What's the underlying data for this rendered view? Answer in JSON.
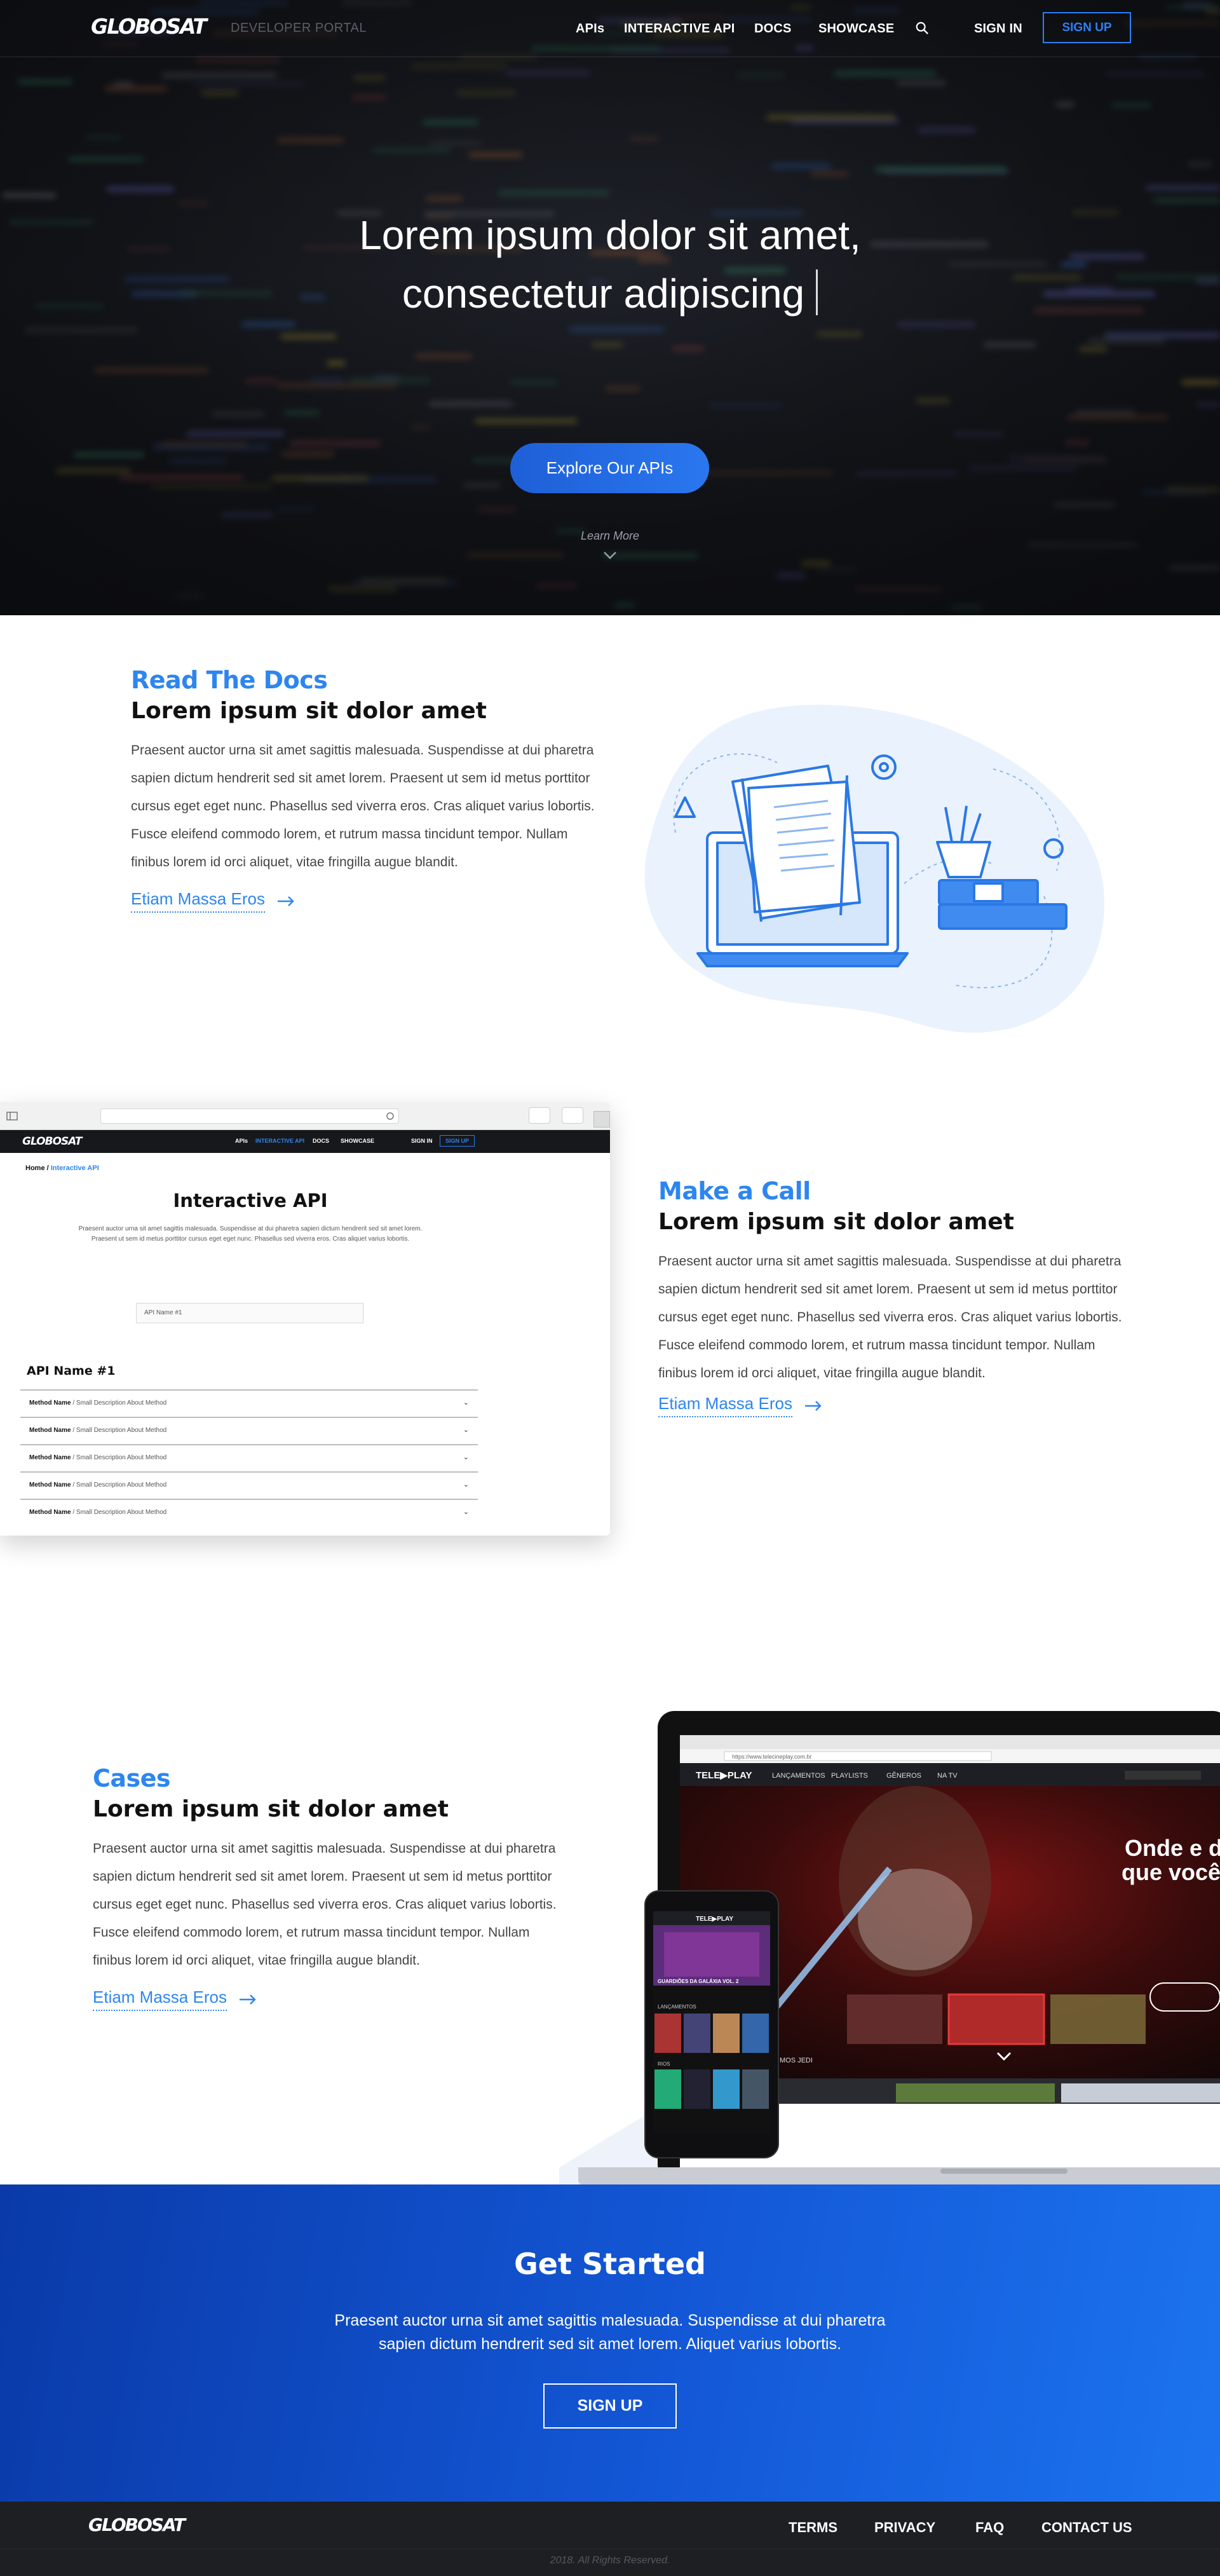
{
  "brand": {
    "logo": "GLOBOSAT",
    "subtitle": "DEVELOPER PORTAL"
  },
  "nav": {
    "items": [
      "APIs",
      "INTERACTIVE API",
      "DOCS",
      "SHOWCASE"
    ],
    "search_icon": "search-icon",
    "signin": "SIGN IN",
    "signup": "SIGN UP"
  },
  "hero": {
    "line1": "Lorem ipsum dolor sit amet,",
    "line2": "consectetur adipiscing",
    "cta": "Explore Our APIs",
    "learn_more": "Learn More"
  },
  "sections": [
    {
      "kicker": "Read The Docs",
      "title": "Lorem ipsum sit dolor amet",
      "body": "Praesent auctor urna sit amet sagittis malesuada. Suspendisse at dui pharetra sapien dictum hendrerit sed sit amet lorem. Praesent ut sem id metus porttitor cursus eget eget nunc. Phasellus sed viverra eros. Cras aliquet varius lobortis. Fusce eleifend commodo lorem, et rutrum massa tincidunt tempor. Nullam finibus lorem id orci aliquet, vitae fringilla augue blandit.",
      "link": "Etiam Massa Eros"
    },
    {
      "kicker": "Make a Call",
      "title": "Lorem ipsum sit dolor amet",
      "body": "Praesent auctor urna sit amet sagittis malesuada. Suspendisse at dui pharetra sapien dictum hendrerit sed sit amet lorem. Praesent ut sem id metus porttitor cursus eget eget nunc. Phasellus sed viverra eros. Cras aliquet varius lobortis. Fusce eleifend commodo lorem, et rutrum massa tincidunt tempor. Nullam finibus lorem id orci aliquet, vitae fringilla augue blandit.",
      "link": "Etiam Massa Eros"
    },
    {
      "kicker": "Cases",
      "title": "Lorem ipsum sit dolor amet",
      "body": "Praesent auctor urna sit amet sagittis malesuada. Suspendisse at dui pharetra sapien dictum hendrerit sed sit amet lorem. Praesent ut sem id metus porttitor cursus eget eget nunc. Phasellus sed viverra eros. Cras aliquet varius lobortis. Fusce eleifend commodo lorem, et rutrum massa tincidunt tempor. Nullam finibus lorem id orci aliquet, vitae fringilla augue blandit.",
      "link": "Etiam Massa Eros"
    }
  ],
  "mock": {
    "logo": "GLOBOSAT",
    "nav": [
      "APIs",
      "INTERACTIVE API",
      "DOCS",
      "SHOWCASE"
    ],
    "signin": "SIGN IN",
    "signup": "SIGN UP",
    "crumb_home": "Home",
    "crumb_current": "Interactive API",
    "title": "Interactive API",
    "desc": "Praesent auctor urna sit amet sagittis malesuada. Suspendisse at dui pharetra sapien dictum hendrerit sed sit amet lorem. Praesent ut sem id metus porttitor cursus eget eget nunc. Phasellus sed viverra eros. Cras aliquet varius lobortis.",
    "select": "API Name #1",
    "api_heading": "API Name #1",
    "rows": [
      {
        "name": "Method Name",
        "desc": "Small Description About Method"
      },
      {
        "name": "Method Name",
        "desc": "Small Description About Method"
      },
      {
        "name": "Method Name",
        "desc": "Small Description About Method"
      },
      {
        "name": "Method Name",
        "desc": "Small Description About Method"
      },
      {
        "name": "Method Name",
        "desc": "Small Description About Method"
      }
    ]
  },
  "showcase": {
    "url": "https://www.telecineplay.com.br",
    "laptop_nav": [
      "LANÇAMENTOS",
      "PLAYLISTS",
      "GÊNEROS",
      "NA TV"
    ],
    "laptop_tagline_1": "Onde e de",
    "laptop_tagline_2": "que você",
    "laptop_row_1": "LANÇAMENTOS",
    "laptop_row_2": "OS ÚLTIMOS JEDI",
    "phone_title": "GUARDIÕES DA GALÁXIA VOL. 2",
    "phone_row_1": "LANÇAMENTOS",
    "phone_row_2": "RIOS"
  },
  "get_started": {
    "title": "Get Started",
    "body": "Praesent auctor urna sit amet sagittis malesuada. Suspendisse at dui pharetra sapien dictum hendrerit sed sit amet lorem.  Aliquet varius lobortis.",
    "button": "SIGN UP"
  },
  "footer": {
    "logo": "GLOBOSAT",
    "links": [
      "TERMS",
      "PRIVACY",
      "FAQ",
      "CONTACT US"
    ],
    "copyright": "2018. All Rights Reserved."
  },
  "colors": {
    "accent": "#2d86ef",
    "cta": "#1e5fd6",
    "banner": "#1357d6",
    "footer": "#1d1f23"
  }
}
